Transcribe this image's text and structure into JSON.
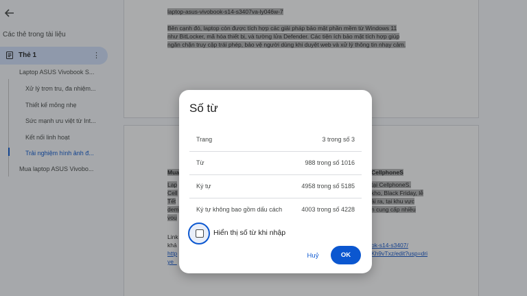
{
  "sidebar": {
    "heading": "Các thẻ trong tài liệu",
    "tab": {
      "label": "Thẻ 1",
      "more": "⋮"
    },
    "outline": [
      {
        "label": "Laptop ASUS Vivobook S..."
      },
      {
        "label": "Xử lý trơn tru, đa nhiệm..."
      },
      {
        "label": "Thiết kế mỏng nhẹ"
      },
      {
        "label": "Sức mạnh ưu việt từ Int..."
      },
      {
        "label": "Kết nối linh hoạt"
      },
      {
        "label": "Trải nghiệm hình ảnh đ..."
      },
      {
        "label": "Mua laptop ASUS Vivobo..."
      }
    ]
  },
  "document": {
    "page1": {
      "slug": "laptop-asus-vivobook-s14-s3407va-ly046w-7",
      "paragraph": [
        "Bên cạnh đó, laptop còn được tích hợp các giải pháp bảo mật phần mềm từ Windows 11",
        "như BitLocker, mã hóa thiết bị, và tường lửa Defender. Các tiện ích bảo mật tích hợp giúp",
        "ngăn chặn truy cập trái phép, bảo vệ người dùng khi duyệt web và xử lý thông tin nhạy cảm."
      ]
    },
    "page2": {
      "left_heading": "Mua",
      "left_lines": [
        "Lap",
        "Cell",
        "Tết",
        "dem",
        "vou"
      ],
      "right_heading": "CellphoneS",
      "right_lines": [
        "tại CellphoneS.",
        "kho, Black Friday, lễ",
        "ải ra, tại khu vực",
        "n cung cấp nhiều"
      ],
      "link_left": [
        "Link",
        "khả",
        "http",
        "ye_"
      ],
      "link_right": [
        "ok-s14-s3407/",
        "Kh9vTxz/edit?usp=dri"
      ]
    }
  },
  "dialog": {
    "title": "Số từ",
    "stats": [
      {
        "label": "Trang",
        "value": "3 trong số 3"
      },
      {
        "label": "Từ",
        "value": "988 trong số 1016"
      },
      {
        "label": "Ký tự",
        "value": "4958 trong số 5185"
      },
      {
        "label": "Ký tự không bao gồm dấu cách",
        "value": "4003 trong số 4228"
      }
    ],
    "checkbox": {
      "label": "Hiển thị số từ khi nhập",
      "checked": false
    },
    "cancel_label": "Huỷ",
    "ok_label": "OK"
  },
  "colors": {
    "accent": "#0b57d0",
    "tab_highlight": "#d3e3fd",
    "text_highlight": "#b7b7b7"
  }
}
